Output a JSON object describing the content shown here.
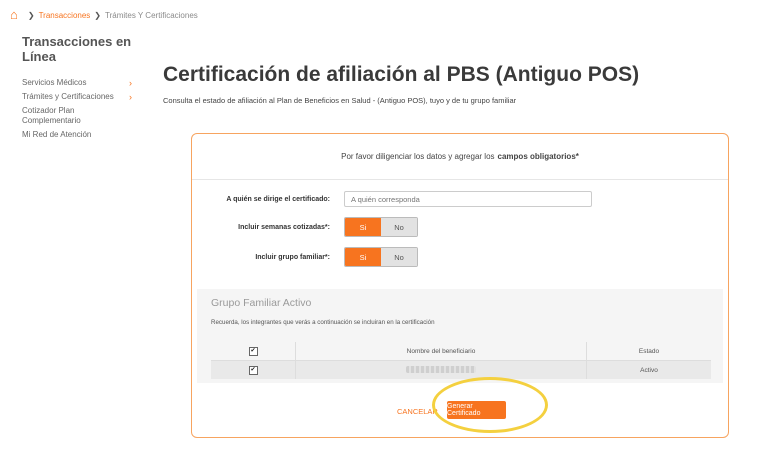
{
  "breadcrumb": {
    "home_icon": "home-icon",
    "items": [
      "Transacciones",
      "Trámites Y Certificaciones"
    ]
  },
  "sidebar": {
    "title": "Transacciones en Línea",
    "items": [
      {
        "label": "Servicios Médicos",
        "chevron": "›"
      },
      {
        "label": "Trámites y Certificaciones",
        "chevron": "›"
      },
      {
        "label": "Cotizador Plan Complementario",
        "chevron": ""
      },
      {
        "label": "Mi Red de Atención",
        "chevron": ""
      }
    ]
  },
  "header": {
    "title": "Certificación de afiliación al PBS (Antiguo POS)",
    "subtitle": "Consulta el estado de afiliación al Plan de Beneficios en Salud - (Antiguo POS), tuyo y de tu grupo familiar"
  },
  "form": {
    "intro": "Por favor diligenciar los datos y agregar los",
    "intro_bold": "campos obligatorios*",
    "recipient_label": "A quién se dirige el certificado:",
    "recipient_placeholder": "A quién corresponda",
    "weeks_label": "Incluir semanas cotizadas*:",
    "family_label": "Incluir grupo familiar*:",
    "yes": "Si",
    "no": "No"
  },
  "group": {
    "title": "Grupo Familiar Activo",
    "note": "Recuerda, los integrantes que verás a continuación se incluiran en la certificación",
    "columns": [
      "",
      "Nombre del beneficiario",
      "Estado"
    ],
    "rows": [
      {
        "checked": true,
        "status": "Activo"
      }
    ]
  },
  "actions": {
    "cancel": "Cancelar",
    "submit": "Generar Certificado"
  },
  "colors": {
    "accent": "#f7741f",
    "highlight": "#f4d03f"
  }
}
